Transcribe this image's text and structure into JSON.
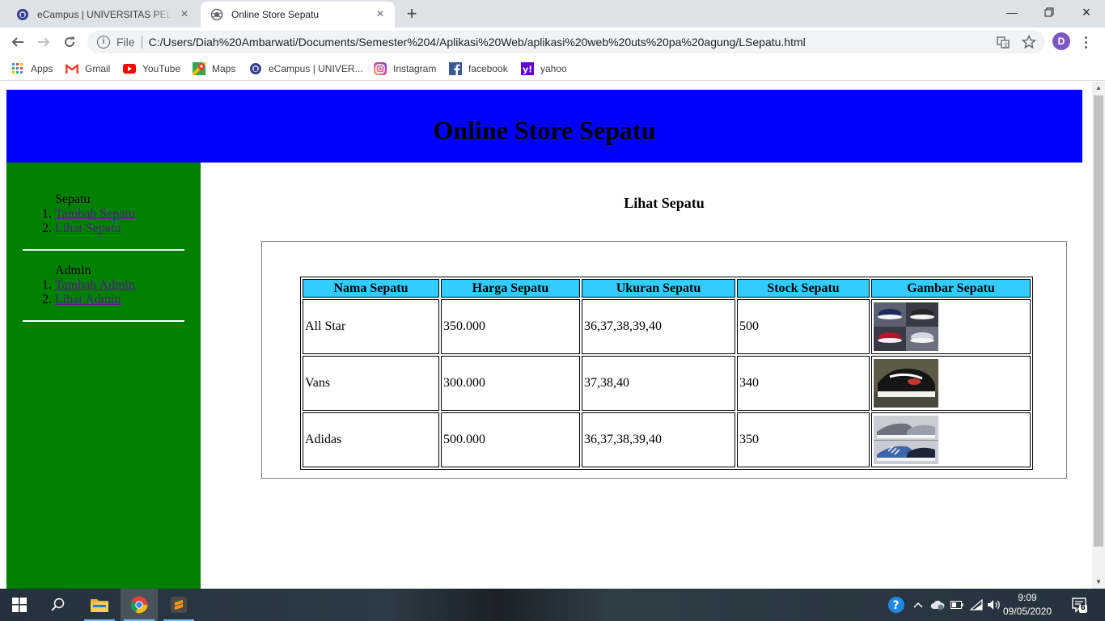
{
  "browser": {
    "tabs": [
      {
        "title": "eCampus | UNIVERSITAS PELITA BANGSA",
        "active": false,
        "favicon": "campus-seal-icon"
      },
      {
        "title": "Online Store Sepatu",
        "active": true,
        "favicon": "globe-icon"
      }
    ],
    "address": {
      "scheme": "File",
      "url": "C:/Users/Diah%20Ambarwati/Documents/Semester%204/Aplikasi%20Web/aplikasi%20web%20uts%20pa%20agung/LSepatu.html"
    },
    "profile_initial": "D",
    "bookmarks": [
      {
        "label": "Apps",
        "icon": "apps-grid-icon"
      },
      {
        "label": "Gmail",
        "icon": "gmail-icon"
      },
      {
        "label": "YouTube",
        "icon": "youtube-icon"
      },
      {
        "label": "Maps",
        "icon": "maps-icon"
      },
      {
        "label": "eCampus | UNIVER...",
        "icon": "campus-seal-icon"
      },
      {
        "label": "Instagram",
        "icon": "instagram-icon"
      },
      {
        "label": "facebook",
        "icon": "facebook-icon"
      },
      {
        "label": "yahoo",
        "icon": "yahoo-icon"
      }
    ]
  },
  "page": {
    "header_title": "Online Store Sepatu",
    "header_color": "#0000ff",
    "sidebar_color": "#008000",
    "sidebar": {
      "sections": [
        {
          "heading": "Sepatu",
          "links": [
            "Tambah Sepatu",
            "Lihat Sepatu"
          ]
        },
        {
          "heading": "Admin",
          "links": [
            "Tambah Admin",
            "Lihat Admin"
          ]
        }
      ]
    },
    "content_title": "Lihat Sepatu",
    "table": {
      "header_color": "#33ccff",
      "columns": [
        "Nama Sepatu",
        "Harga Sepatu",
        "Ukuran Sepatu",
        "Stock Sepatu",
        "Gambar Sepatu"
      ],
      "rows": [
        {
          "nama": "All Star",
          "harga": "350.000",
          "ukuran": "36,37,38,39,40",
          "stock": "500",
          "gambar": "converse-all-star-photo"
        },
        {
          "nama": "Vans",
          "harga": "300.000",
          "ukuran": "37,38,40",
          "stock": "340",
          "gambar": "vans-shoe-photo"
        },
        {
          "nama": "Adidas",
          "harga": "500.000",
          "ukuran": "36,37,38,39,40",
          "stock": "350",
          "gambar": "adidas-shoe-photo"
        }
      ]
    }
  },
  "taskbar": {
    "time": "9:09",
    "date": "09/05/2020",
    "notification_count": "6",
    "apps": [
      "file-explorer-icon",
      "chrome-icon",
      "sublime-text-icon"
    ]
  }
}
